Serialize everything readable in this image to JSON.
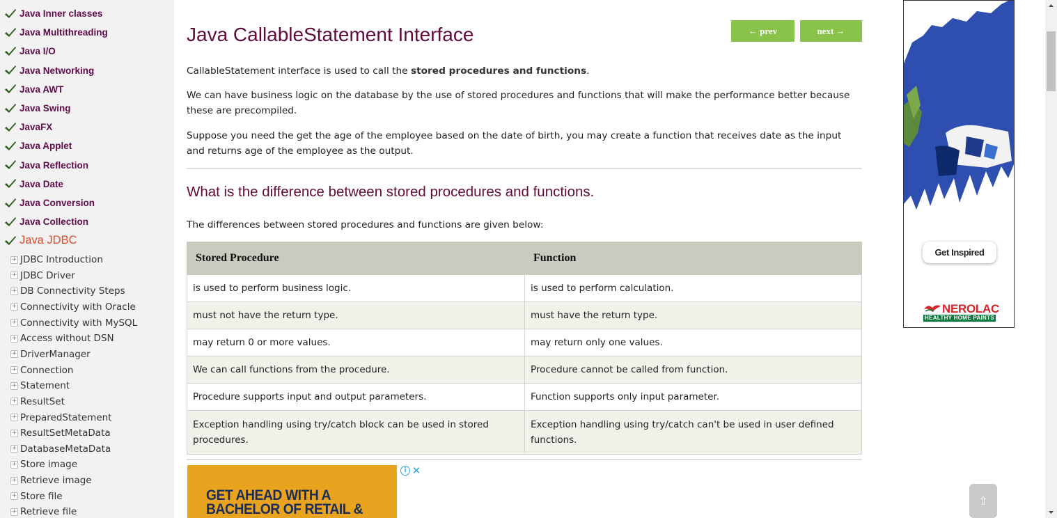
{
  "sidebar": {
    "topics": [
      {
        "label": "Java Inner classes"
      },
      {
        "label": "Java Multithreading"
      },
      {
        "label": "Java I/O"
      },
      {
        "label": "Java Networking"
      },
      {
        "label": "Java AWT"
      },
      {
        "label": "Java Swing"
      },
      {
        "label": "JavaFX"
      },
      {
        "label": "Java Applet"
      },
      {
        "label": "Java Reflection"
      },
      {
        "label": "Java Date"
      },
      {
        "label": "Java Conversion"
      },
      {
        "label": "Java Collection"
      },
      {
        "label": "Java JDBC"
      }
    ],
    "subitems": [
      {
        "label": "JDBC Introduction"
      },
      {
        "label": "JDBC Driver"
      },
      {
        "label": "DB Connectivity Steps"
      },
      {
        "label": "Connectivity with Oracle"
      },
      {
        "label": "Connectivity with MySQL"
      },
      {
        "label": "Access without DSN"
      },
      {
        "label": "DriverManager"
      },
      {
        "label": "Connection"
      },
      {
        "label": "Statement"
      },
      {
        "label": "ResultSet"
      },
      {
        "label": "PreparedStatement"
      },
      {
        "label": "ResultSetMetaData"
      },
      {
        "label": "DatabaseMetaData"
      },
      {
        "label": "Store image"
      },
      {
        "label": "Retrieve image"
      },
      {
        "label": "Store file"
      },
      {
        "label": "Retrieve file"
      }
    ],
    "colors": {
      "topic": "#610b4b",
      "active_topic": "#e04a2a",
      "check": "#2a5d1a"
    }
  },
  "main": {
    "title": "Java CallableStatement Interface",
    "prev_label": "← prev",
    "next_label": "next →",
    "intro_text": "CallableStatement interface is used to call the ",
    "intro_bold": "stored procedures and functions",
    "intro_end": ".",
    "para2": "We can have business logic on the database by the use of stored procedures and functions that will make the performance better because these are precompiled.",
    "para3": "Suppose you need the get the age of the employee based on the date of birth, you may create a function that receives date as the input and returns age of the employee as the output.",
    "section_heading": "What is the difference between stored procedures and functions.",
    "section_intro": "The differences between stored procedures and functions are given below:",
    "table": {
      "headers": [
        "Stored Procedure",
        "Function"
      ],
      "rows": [
        [
          "is used to perform business logic.",
          "is used to perform calculation."
        ],
        [
          "must not have the return type.",
          "must have the return type."
        ],
        [
          "may return 0 or more values.",
          "may return only one values."
        ],
        [
          "We can call functions from the procedure.",
          "Procedure cannot be called from function."
        ],
        [
          "Procedure supports input and output parameters.",
          "Function supports only input parameter."
        ],
        [
          "Exception handling using try/catch block can be used in stored procedures.",
          "Exception handling using try/catch can't be used in user defined functions."
        ]
      ]
    },
    "colors": {
      "heading": "#610b38",
      "nav_button": "#8ac34a",
      "table_header": "#c7ccbe",
      "table_alt_row": "#eef2e9"
    }
  },
  "ads": {
    "bottom_line1": "GET AHEAD WITH A",
    "bottom_line2": "BACHELOR OF RETAIL &",
    "right_button": "Get Inspired",
    "right_brand": "NEROLAC",
    "right_tagline": "HEALTHY HOME PAINTS"
  },
  "scroll_top_icon": "⇧"
}
